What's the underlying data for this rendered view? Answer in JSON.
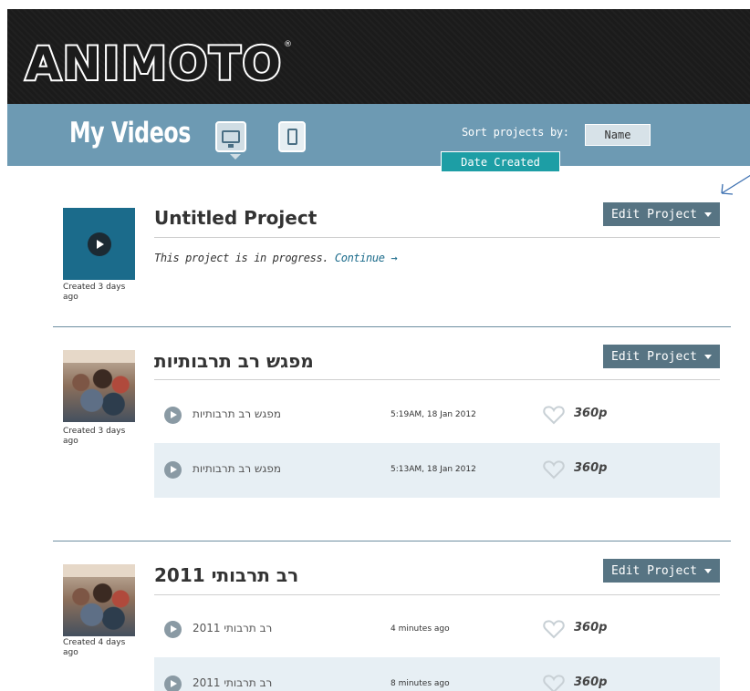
{
  "app": {
    "logo": "ANIMOTO",
    "logo_mark": "®"
  },
  "toolbar": {
    "title": "My Videos",
    "sort_label": "Sort projects by:",
    "sort_name": "Name",
    "sort_date": "Date Created"
  },
  "colors": {
    "header_bg": "#1b1b1b",
    "toolbar_bg": "#6d9ab3",
    "accent_teal": "#1d9ea5",
    "edit_button": "#577483",
    "row_alt": "#e7eff4"
  },
  "projects": [
    {
      "title": "Untitled Project",
      "created": "Created 3 days ago",
      "edit_label": "Edit Project",
      "status_text": "This project is in progress.",
      "continue_label": "Continue →",
      "videos": []
    },
    {
      "title": "מפגש רב תרבותיות",
      "created": "Created 3 days ago",
      "edit_label": "Edit Project",
      "videos": [
        {
          "name": "מפגש רב תרבותיות",
          "date": "5:19AM, 18 Jan 2012",
          "resolution": "360p"
        },
        {
          "name": "מפגש רב תרבותיות",
          "date": "5:13AM, 18 Jan 2012",
          "resolution": "360p"
        }
      ]
    },
    {
      "title": "רב תרבותי 2011",
      "created": "Created 4 days ago",
      "edit_label": "Edit Project",
      "videos": [
        {
          "name": "רב תרבותי 2011",
          "date": "4 minutes ago",
          "resolution": "360p"
        },
        {
          "name": "רב תרבותי 2011",
          "date": "8 minutes ago",
          "resolution": "360p"
        }
      ]
    }
  ]
}
